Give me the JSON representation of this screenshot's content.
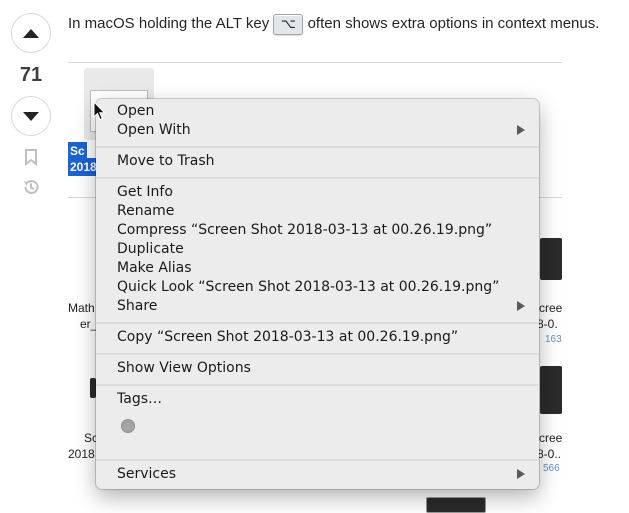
{
  "vote": {
    "count": "71"
  },
  "post": {
    "text_before": "In macOS holding the ALT key",
    "key": "⌥",
    "text_after": "often shows extra options in context menus."
  },
  "finder_background": {
    "selected_label_line1": "Sc",
    "selected_label_line2": "2018",
    "left_file_line1": "Math",
    "left_file_line2": "er_",
    "left_file2_line1": "Sc",
    "left_file2_line2": "2018",
    "right_file_line1": "cree",
    "right_file_line2": "8-0.",
    "right_file_size": "163",
    "right_file2_line1": "cree",
    "right_file2_line2": "8-0..",
    "right_file2_size": "566"
  },
  "context_menu": {
    "items": [
      {
        "label": "Open"
      },
      {
        "label": "Open With"
      },
      {
        "label": "Move to Trash"
      },
      {
        "label": "Get Info"
      },
      {
        "label": "Rename"
      },
      {
        "label": "Compress “Screen Shot 2018-03-13 at 00.26.19.png”"
      },
      {
        "label": "Duplicate"
      },
      {
        "label": "Make Alias"
      },
      {
        "label": "Quick Look “Screen Shot 2018-03-13 at 00.26.19.png”"
      },
      {
        "label": "Share"
      },
      {
        "label": "Copy “Screen Shot 2018-03-13 at 00.26.19.png”"
      },
      {
        "label": "Show View Options"
      },
      {
        "label": "Tags…"
      },
      {
        "label": "Services"
      }
    ],
    "tag_color": "#a4a4a4"
  },
  "icons": [
    "arrow-up-icon",
    "arrow-down-icon",
    "bookmark-icon",
    "history-icon",
    "chevron-right-icon",
    "mouse-pointer-icon"
  ]
}
